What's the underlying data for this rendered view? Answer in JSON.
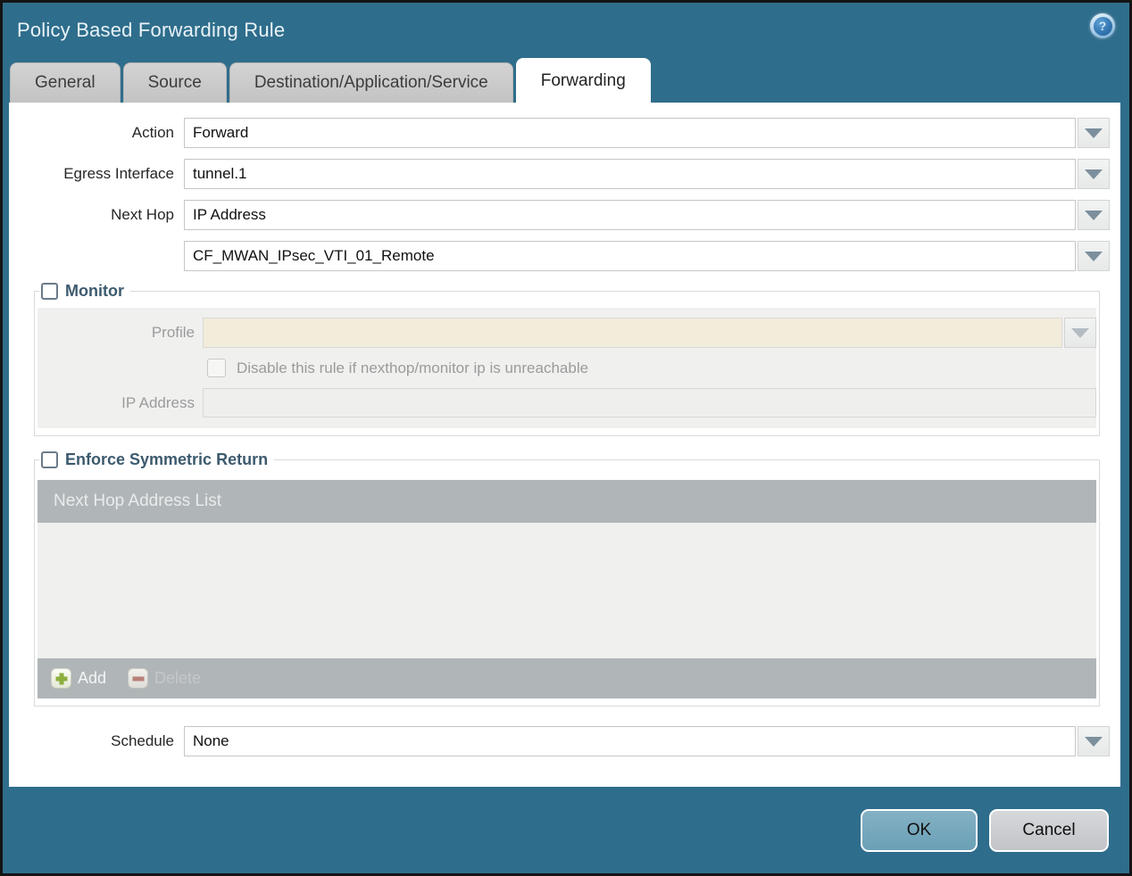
{
  "title": "Policy Based Forwarding Rule",
  "help_glyph": "?",
  "tabs": [
    {
      "label": "General",
      "active": false
    },
    {
      "label": "Source",
      "active": false
    },
    {
      "label": "Destination/Application/Service",
      "active": false
    },
    {
      "label": "Forwarding",
      "active": true
    }
  ],
  "form": {
    "action": {
      "label": "Action",
      "value": "Forward"
    },
    "egress_interface": {
      "label": "Egress Interface",
      "value": "tunnel.1"
    },
    "next_hop": {
      "label": "Next Hop",
      "value": "IP Address"
    },
    "next_hop_address": {
      "value": "CF_MWAN_IPsec_VTI_01_Remote"
    },
    "schedule": {
      "label": "Schedule",
      "value": "None"
    }
  },
  "monitor": {
    "title": "Monitor",
    "checked": false,
    "profile": {
      "label": "Profile",
      "value": ""
    },
    "disable_rule": {
      "label": "Disable this rule if nexthop/monitor ip is unreachable",
      "checked": false
    },
    "ip_address": {
      "label": "IP Address",
      "value": ""
    }
  },
  "symmetric_return": {
    "title": "Enforce Symmetric Return",
    "checked": false,
    "list_header": "Next Hop Address List",
    "rows": [],
    "add_label": "Add",
    "delete_label": "Delete"
  },
  "footer": {
    "ok": "OK",
    "cancel": "Cancel"
  },
  "colors": {
    "header_teal": "#2f6d8c",
    "ok_button": "#74a7bc",
    "section_title": "#3d5a6e",
    "table_gray": "#b0b5b8",
    "disabled_field_cream": "#f2ecda",
    "add_green": "#8cae3e",
    "delete_red": "#b78079"
  }
}
